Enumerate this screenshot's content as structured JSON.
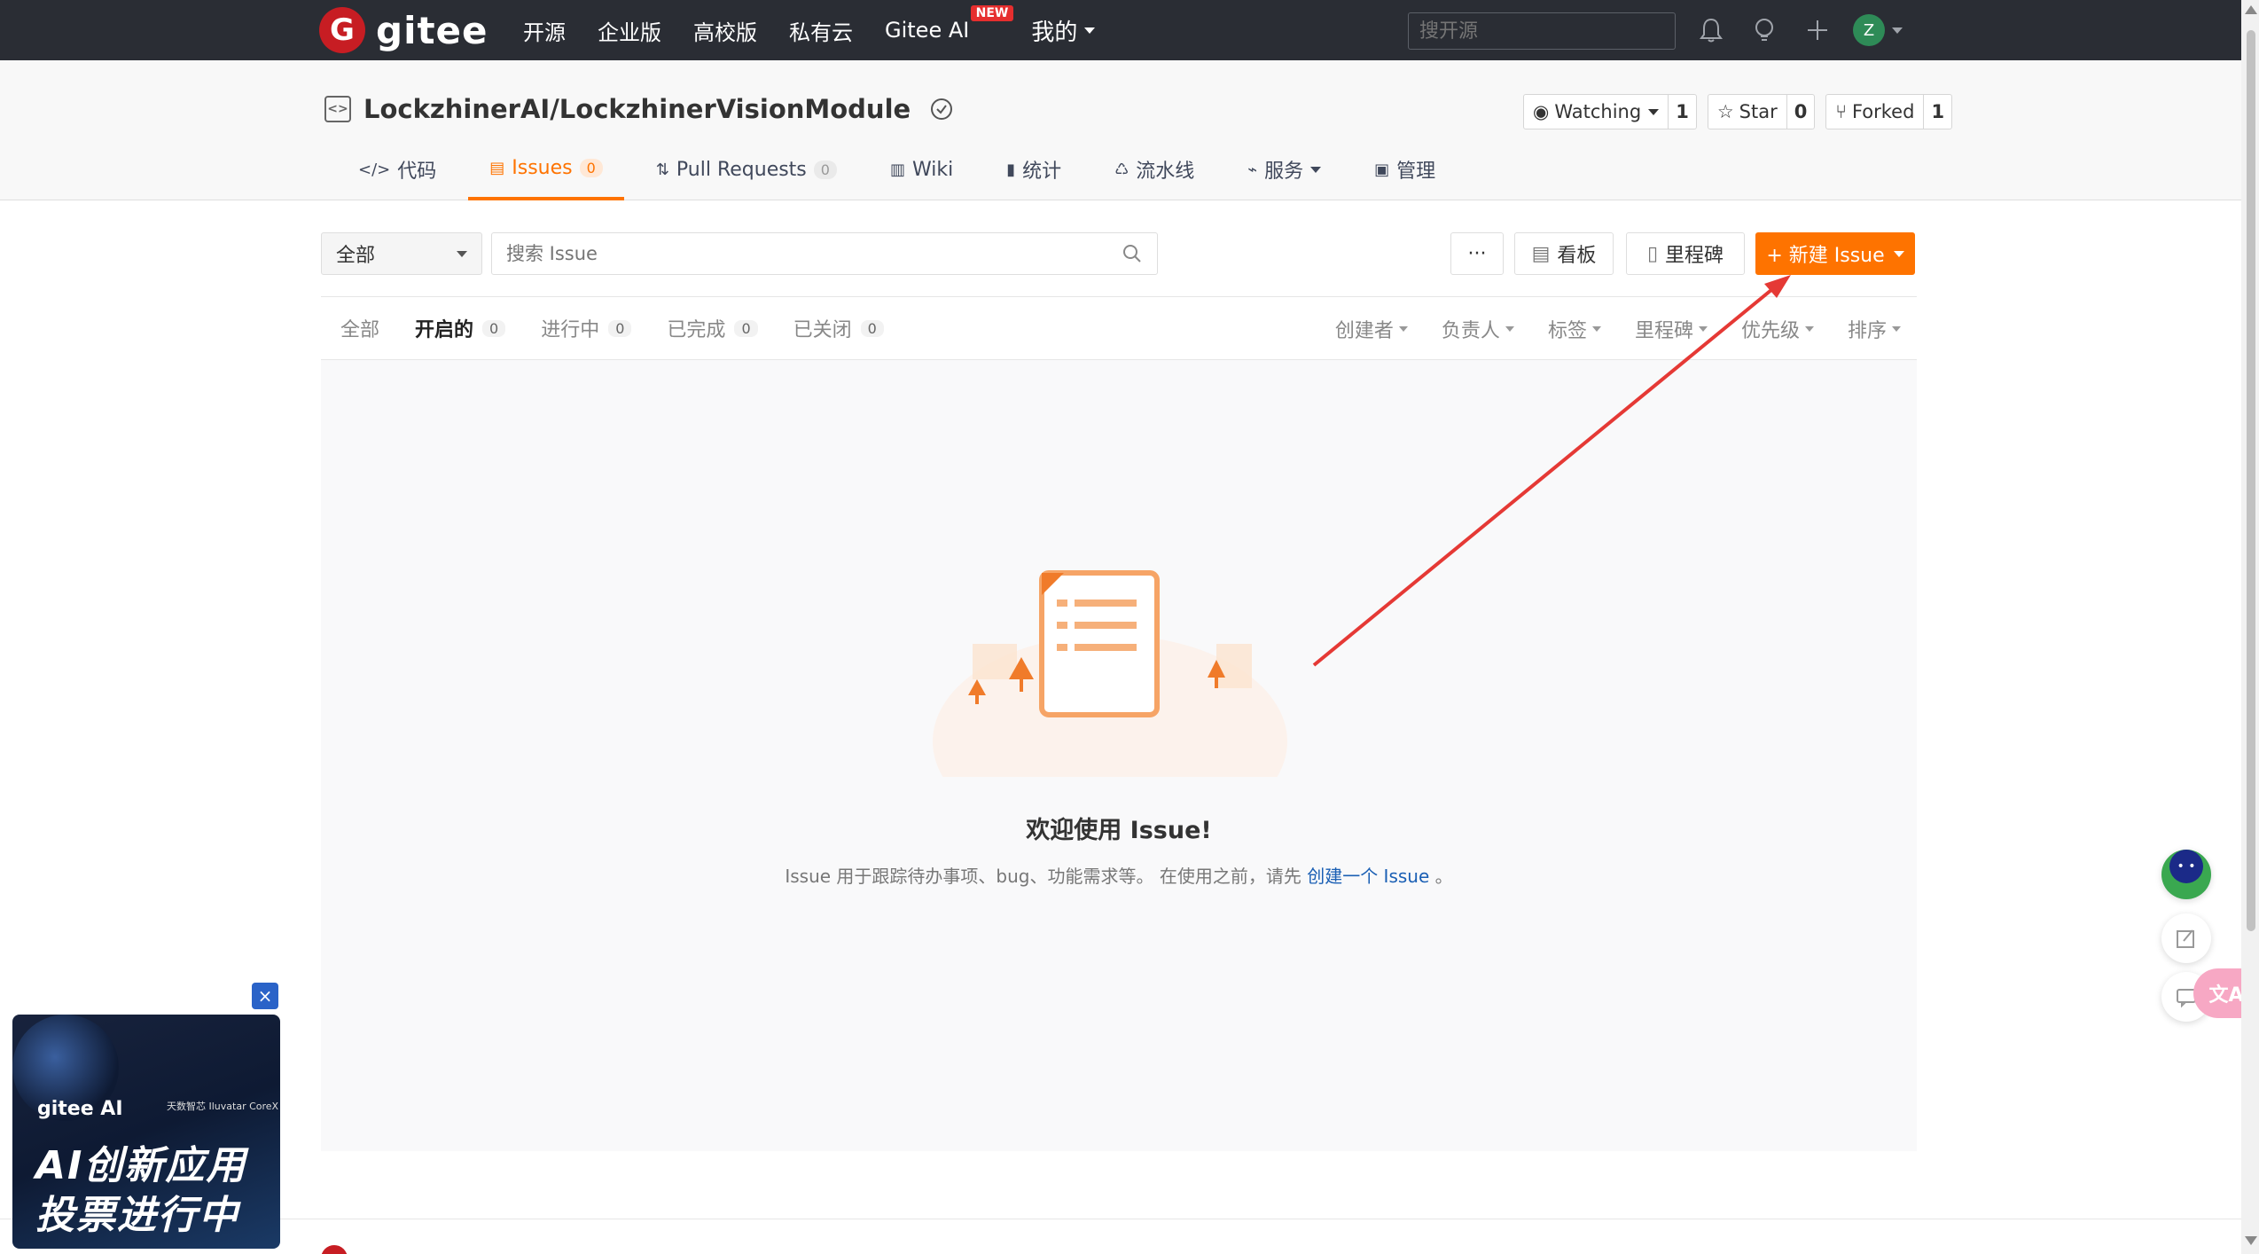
{
  "topnav": {
    "logo_mark": "G",
    "logo_text": "gitee",
    "links": [
      "开源",
      "企业版",
      "高校版",
      "私有云"
    ],
    "ai_label": "Gitee AI",
    "ai_badge": "NEW",
    "mine_label": "我的",
    "search_placeholder": "搜开源",
    "avatar_letter": "Z"
  },
  "repo": {
    "title": "LockzhinerAI/LockzhinerVisionModule",
    "watch": {
      "label": "Watching",
      "count": "1"
    },
    "star": {
      "label": "Star",
      "count": "0"
    },
    "fork": {
      "label": "Forked",
      "count": "1"
    }
  },
  "tabs": [
    {
      "icon": "</>",
      "label": "代码"
    },
    {
      "icon": "▤",
      "label": "Issues",
      "count": "0"
    },
    {
      "icon": "⇅",
      "label": "Pull Requests",
      "count": "0"
    },
    {
      "icon": "▥",
      "label": "Wiki"
    },
    {
      "icon": "▮",
      "label": "统计"
    },
    {
      "icon": "♺",
      "label": "流水线"
    },
    {
      "icon": "⌁",
      "label": "服务"
    },
    {
      "icon": "▣",
      "label": "管理"
    }
  ],
  "toolbar": {
    "filter_value": "全部",
    "search_placeholder": "搜索 Issue",
    "more_label": "···",
    "board_label": "看板",
    "milestone_label": "里程碑",
    "new_issue_label": "+ 新建 Issue"
  },
  "status_tabs": [
    {
      "label": "全部"
    },
    {
      "label": "开启的",
      "count": "0"
    },
    {
      "label": "进行中",
      "count": "0"
    },
    {
      "label": "已完成",
      "count": "0"
    },
    {
      "label": "已关闭",
      "count": "0"
    }
  ],
  "sort_filters": [
    "创建者",
    "负责人",
    "标签",
    "里程碑",
    "优先级",
    "排序"
  ],
  "empty": {
    "title": "欢迎使用 Issue!",
    "desc_prefix": "Issue 用于跟踪待办事项、bug、功能需求等。 在使用之前，请先",
    "desc_link": "创建一个 Issue",
    "desc_suffix": "。"
  },
  "ad": {
    "brand": "gitee AI",
    "partner": "天数智芯 Iluvatar CoreX",
    "line1": "AI创新应用",
    "line2": "投票进行中",
    "close": "×"
  },
  "translate_label": "文A",
  "colors": {
    "accent": "#fe7300",
    "nav_bg": "#2a2d34",
    "brand_red": "#c71d23",
    "annotation": "#e53935",
    "link": "#1a5fb4"
  }
}
